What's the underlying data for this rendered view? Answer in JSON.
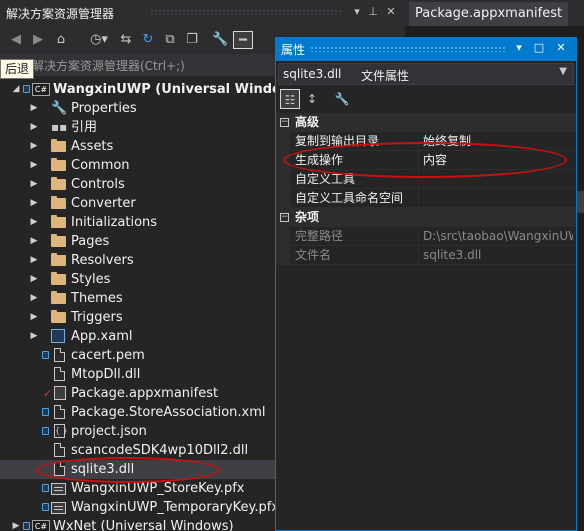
{
  "solution_explorer": {
    "title": "解决方案资源管理器",
    "search_placeholder": "解决方案资源管理器(Ctrl+;)",
    "tooltip_back": "后退",
    "project": "WangxinUWP (Universal Windows)",
    "items": [
      {
        "label": "Properties",
        "icon": "wrench-icon"
      },
      {
        "label": "引用",
        "icon": "references-icon"
      },
      {
        "label": "Assets",
        "icon": "folder-icon"
      },
      {
        "label": "Common",
        "icon": "folder-icon"
      },
      {
        "label": "Controls",
        "icon": "folder-icon"
      },
      {
        "label": "Converter",
        "icon": "folder-icon"
      },
      {
        "label": "Initializations",
        "icon": "folder-icon"
      },
      {
        "label": "Pages",
        "icon": "folder-icon"
      },
      {
        "label": "Resolvers",
        "icon": "folder-icon"
      },
      {
        "label": "Styles",
        "icon": "folder-icon"
      },
      {
        "label": "Themes",
        "icon": "folder-icon"
      },
      {
        "label": "Triggers",
        "icon": "folder-icon"
      },
      {
        "label": "App.xaml",
        "icon": "xaml-file-icon"
      },
      {
        "label": "cacert.pem",
        "icon": "file-icon"
      },
      {
        "label": "MtopDll.dll",
        "icon": "file-icon"
      },
      {
        "label": "Package.appxmanifest",
        "icon": "manifest-icon"
      },
      {
        "label": "Package.StoreAssociation.xml",
        "icon": "file-icon"
      },
      {
        "label": "project.json",
        "icon": "json-file-icon"
      },
      {
        "label": "scancodeSDK4wp10Dll2.dll",
        "icon": "file-icon"
      },
      {
        "label": "sqlite3.dll",
        "icon": "file-icon"
      },
      {
        "label": "WangxinUWP_StoreKey.pfx",
        "icon": "certificate-icon"
      },
      {
        "label": "WangxinUWP_TemporaryKey.pfx",
        "icon": "certificate-icon"
      }
    ],
    "next_project": "WxNet (Universal Windows)"
  },
  "document": {
    "tab": "Package.appxmanifest"
  },
  "properties": {
    "title": "属性",
    "object_name": "sqlite3.dll",
    "object_kind": "文件属性",
    "categories": [
      {
        "name": "高级",
        "rows": [
          {
            "name": "复制到输出目录",
            "value": "始终复制"
          },
          {
            "name": "生成操作",
            "value": "内容"
          },
          {
            "name": "自定义工具",
            "value": ""
          },
          {
            "name": "自定义工具命名空间",
            "value": ""
          }
        ]
      },
      {
        "name": "杂项",
        "rows": [
          {
            "name": "完整路径",
            "value": "D:\\src\\taobao\\WangxinUW"
          },
          {
            "name": "文件名",
            "value": "sqlite3.dll"
          }
        ]
      }
    ]
  },
  "colors": {
    "accent": "#007acc",
    "annotation": "#cc1010",
    "folder": "#dcb67a"
  }
}
